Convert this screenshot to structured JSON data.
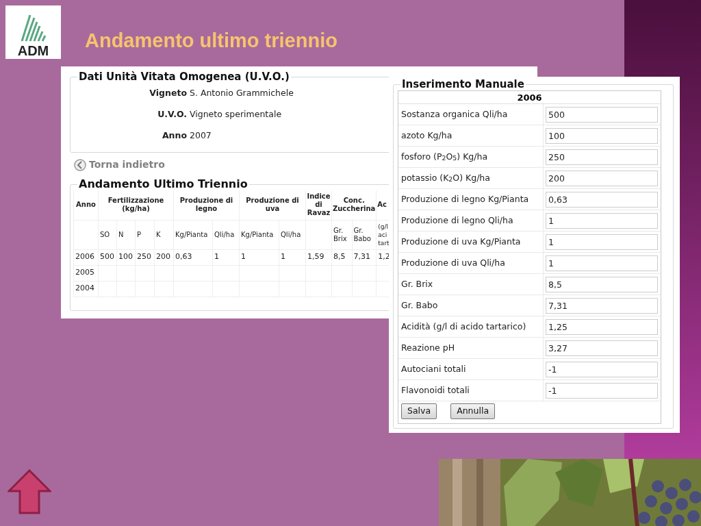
{
  "slide": {
    "title": "Andamento ultimo triennio",
    "logo_text": "ADM"
  },
  "uvo_panel": {
    "legend": "Dati Unità Vitata Omogenea (U.V.O.)",
    "fields": [
      {
        "label": "Vigneto",
        "value": "S. Antonio Grammichele"
      },
      {
        "label": "U.V.O.",
        "value": "Vigneto sperimentale"
      },
      {
        "label": "Anno",
        "value": "2007"
      }
    ]
  },
  "back_link": "Torna indietro",
  "trend_panel": {
    "legend": "Andamento Ultimo Triennio",
    "groups": [
      {
        "label": "Anno"
      },
      {
        "label": "Fertilizzazione (kg/ha)",
        "columns": [
          "SO",
          "N",
          "P",
          "K"
        ]
      },
      {
        "label": "Produzione di legno",
        "columns": [
          "Kg/Pianta",
          "Qli/ha"
        ]
      },
      {
        "label": "Produzione di uva",
        "columns": [
          "Kg/Pianta",
          "Qli/ha"
        ]
      },
      {
        "label": "Indice di Ravaz"
      },
      {
        "label": "Conc. Zuccherina",
        "columns": [
          "Gr. Brix",
          "Gr. Babo"
        ]
      },
      {
        "label": "Ac",
        "columns": [
          "(g/l aci tart"
        ]
      }
    ],
    "rows": [
      [
        "2006",
        "500",
        "100",
        "250",
        "200",
        "0,63",
        "1",
        "1",
        "1",
        "1,59",
        "8,5",
        "7,31",
        "1,2"
      ],
      [
        "2005"
      ],
      [
        "2004"
      ]
    ]
  },
  "manual_entry": {
    "legend": "Inserimento Manuale",
    "year": "2006",
    "fields": [
      {
        "label": "Sostanza organica Qli/ha",
        "value": "500"
      },
      {
        "label": "azoto Kg/ha",
        "value": "100"
      },
      {
        "label": "fosforo (P$_{2}$O$_{5}$) Kg/ha",
        "value": "250"
      },
      {
        "label": "potassio (K$_{2}$O) Kg/ha",
        "value": "200"
      },
      {
        "label": "Produzione di legno Kg/Pianta",
        "value": "0,63"
      },
      {
        "label": "Produzione di legno Qli/ha",
        "value": "1"
      },
      {
        "label": "Produzione di uva Kg/Pianta",
        "value": "1"
      },
      {
        "label": "Produzione di uva Qli/ha",
        "value": "1"
      },
      {
        "label": "Gr. Brix",
        "value": "8,5"
      },
      {
        "label": "Gr. Babo",
        "value": "7,31"
      },
      {
        "label": "Acidità (g/l di acido tartarico)",
        "value": "1,25"
      },
      {
        "label": "Reazione pH",
        "value": "3,27"
      },
      {
        "label": "Autociani totali",
        "value": "-1"
      },
      {
        "label": "Flavonoidi totali",
        "value": "-1"
      }
    ],
    "buttons": [
      "Salva",
      "Annulla"
    ]
  }
}
